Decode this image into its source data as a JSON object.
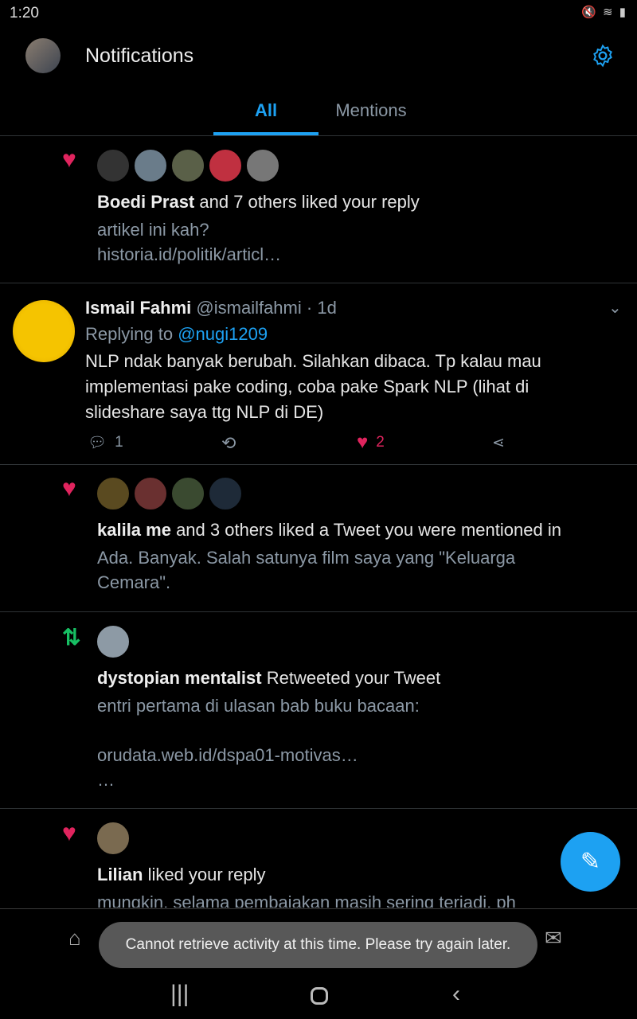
{
  "status": {
    "time": "1:20",
    "icons": "mute wifi signal battery"
  },
  "header": {
    "title": "Notifications",
    "settings_icon": "gear-icon"
  },
  "tabs": [
    {
      "label": "All",
      "active": true
    },
    {
      "label": "Mentions",
      "active": false
    }
  ],
  "colors": {
    "accent": "#1da1f2",
    "like": "#e0245e",
    "retweet": "#17bf63"
  },
  "notifications": [
    {
      "type": "like",
      "actor": "Boedi Prast",
      "text": " and 7 others liked your reply",
      "preview": [
        "artikel ini kah?",
        "historia.id/politik/articl…"
      ]
    },
    {
      "type": "tweet",
      "name": "Ismail Fahmi",
      "handle": "@ismailfahmi",
      "time": "· 1d",
      "replying_label": "Replying to ",
      "replying_to": "@nugi1209",
      "body": "NLP ndak banyak berubah. Silahkan dibaca. Tp kalau mau implementasi pake coding, coba pake Spark NLP (lihat di slideshare saya ttg NLP di DE)",
      "replies": "1",
      "likes": "2"
    },
    {
      "type": "like",
      "actor": "kalila me",
      "text": " and 3 others liked a Tweet you were mentioned in",
      "preview": [
        "Ada. Banyak. Salah satunya film saya yang \"Keluarga Cemara\"."
      ]
    },
    {
      "type": "retweet",
      "actor": "dystopian mentalist",
      "text": " Retweeted your Tweet",
      "preview": [
        "entri pertama di ulasan bab buku bacaan:",
        "",
        "orudata.web.id/dspa01-motivas…",
        "…"
      ]
    },
    {
      "type": "like",
      "actor": "Lilian",
      "text": " liked your reply",
      "preview": [
        "mungkin, selama pembajakan masih sering terjadi, ph"
      ]
    }
  ],
  "toast": "Cannot retrieve activity at this time. Please try again later."
}
